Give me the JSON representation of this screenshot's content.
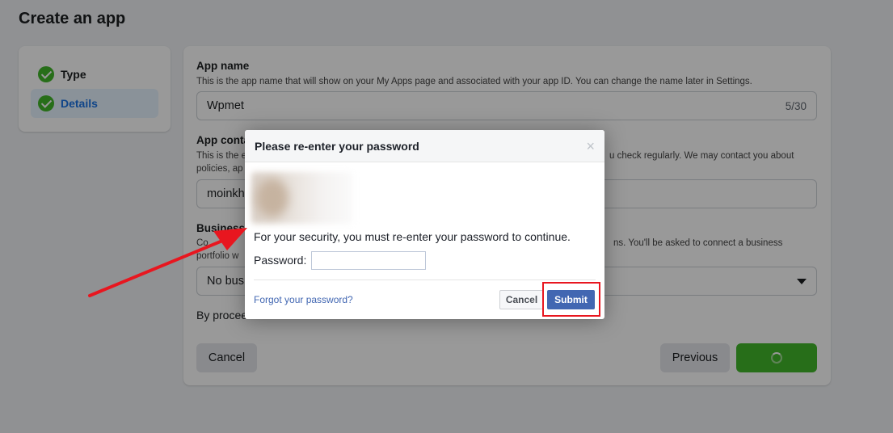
{
  "page": {
    "title": "Create an app"
  },
  "steps": [
    {
      "label": "Type",
      "done": true
    },
    {
      "label": "Details",
      "done": true,
      "active": true
    }
  ],
  "form": {
    "app_name_label": "App name",
    "app_name_help": "This is the app name that will show on your My Apps page and associated with your app ID. You can change the name later in Settings.",
    "app_name_value": "Wpmet",
    "app_name_counter": "5/30",
    "contact_label": "App conta",
    "contact_help_line1_left": "This is the e",
    "contact_help_line1_right": "u check regularly. We may contact you about",
    "contact_help_line2_left": "policies, ap",
    "contact_value": "moinkha",
    "business_label": "Business",
    "business_help_line1_left": "Co",
    "business_help_line1_right": "ns. You'll be asked to connect a business",
    "business_help_line2_left": "portfolio w",
    "business_select_value": "No busi",
    "agreement_text": "By procee",
    "cancel_label": "Cancel",
    "previous_label": "Previous"
  },
  "dialog": {
    "title": "Please re-enter your password",
    "close_glyph": "×",
    "message": "For your security, you must re-enter your password to continue.",
    "password_label": "Password:",
    "password_value": "",
    "forgot_link": "Forgot your password?",
    "cancel_label": "Cancel",
    "submit_label": "Submit"
  },
  "annotations": {
    "arrow_color": "#e8161f",
    "box_color": "#e8161f"
  },
  "colors": {
    "accent": "#1b74e4",
    "success": "#42b72a",
    "dialog_primary": "#4267b2"
  },
  "icons": {
    "step_check": "check-circle-icon",
    "dialog_close": "close-icon",
    "select_caret": "caret-down-icon",
    "loading": "spinner-icon"
  }
}
